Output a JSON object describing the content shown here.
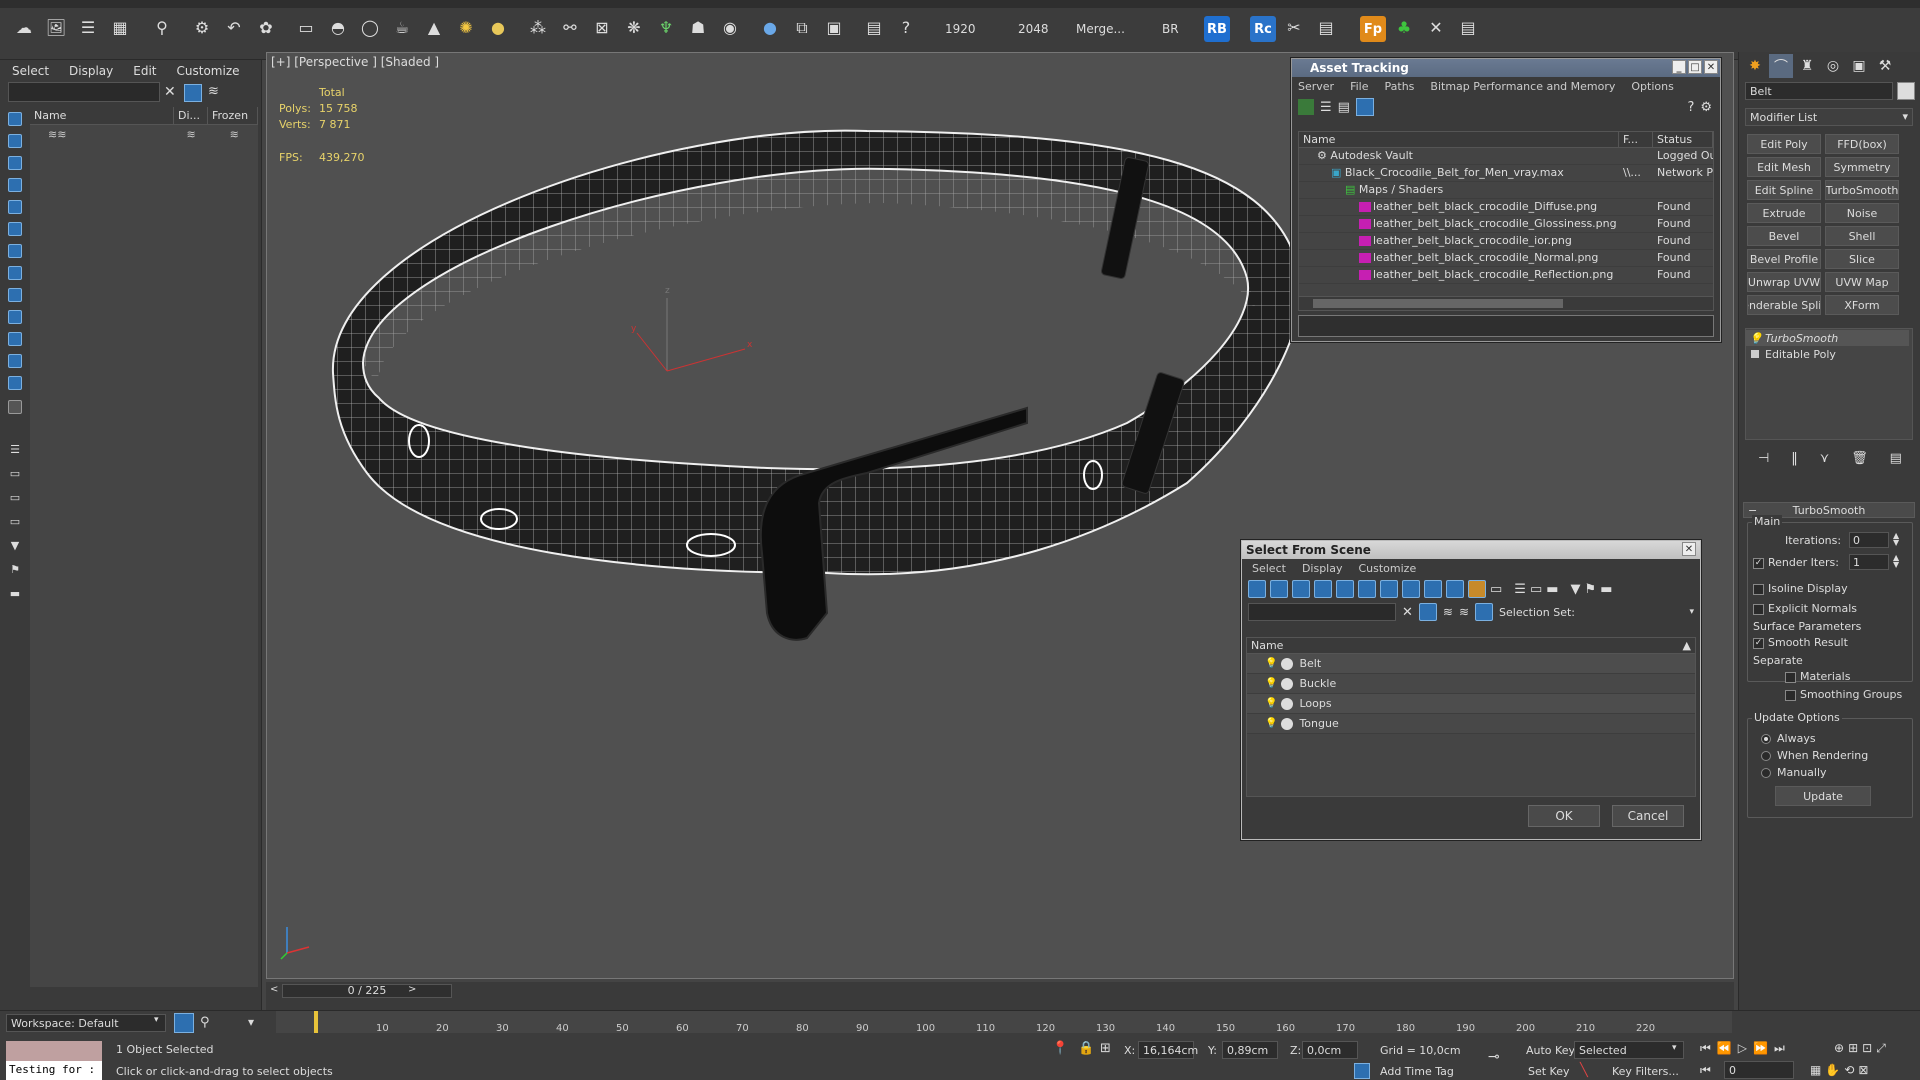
{
  "toolbar": {
    "res_width": "1920",
    "res_height": "2048",
    "merge_label": "Merge...",
    "br_label": "BR",
    "rb_label": "RB",
    "rc_label": "Rc",
    "fp_label": "Fp",
    "icons": [
      "select-object-icon",
      "open-icon",
      "layers-icon",
      "explorer-icon",
      "link-icon",
      "bind-icon",
      "undo-icon",
      "paint-icon",
      "box-icon",
      "sphere-icon",
      "cylinder-icon",
      "teapot-icon",
      "cone-icon",
      "light-icon",
      "geosphere-icon",
      "particles-icon",
      "bone-icon",
      "helper-icon",
      "space-warp-icon",
      "hair-icon",
      "render-icon",
      "material-icon",
      "render-setup-icon",
      "frame-icon",
      "help-icon"
    ]
  },
  "explorer": {
    "menus": [
      "Select",
      "Display",
      "Edit",
      "Customize"
    ],
    "columns": [
      "Name",
      "Di...",
      "Frozen"
    ],
    "workspace": "Workspace: Default"
  },
  "viewport": {
    "label": "[+] [Perspective ] [Shaded ]",
    "stats": {
      "header": "Total",
      "polys_label": "Polys:",
      "polys_value": "15 758",
      "verts_label": "Verts:",
      "verts_value": "7 871",
      "fps_label": "FPS:",
      "fps_value": "439,270"
    }
  },
  "asset_tracking": {
    "title": "Asset Tracking",
    "menus": [
      "Server",
      "File",
      "Paths",
      "Bitmap Performance and Memory",
      "Options"
    ],
    "columns": [
      "Name",
      "F...",
      "Status"
    ],
    "rows": [
      {
        "name": "Autodesk Vault",
        "path": "",
        "status": "Logged Ou",
        "indent": 1,
        "icon": "vault"
      },
      {
        "name": "Black_Crocodile_Belt_for_Men_vray.max",
        "path": "\\\\...",
        "status": "Network Pa",
        "indent": 2,
        "icon": "max"
      },
      {
        "name": "Maps / Shaders",
        "path": "",
        "status": "",
        "indent": 3,
        "icon": "maps"
      },
      {
        "name": "leather_belt_black_crocodile_Diffuse.png",
        "path": "",
        "status": "Found",
        "indent": 4,
        "icon": "png"
      },
      {
        "name": "leather_belt_black_crocodile_Glossiness.png",
        "path": "",
        "status": "Found",
        "indent": 4,
        "icon": "png"
      },
      {
        "name": "leather_belt_black_crocodile_ior.png",
        "path": "",
        "status": "Found",
        "indent": 4,
        "icon": "png"
      },
      {
        "name": "leather_belt_black_crocodile_Normal.png",
        "path": "",
        "status": "Found",
        "indent": 4,
        "icon": "png"
      },
      {
        "name": "leather_belt_black_crocodile_Reflection.png",
        "path": "",
        "status": "Found",
        "indent": 4,
        "icon": "png"
      }
    ]
  },
  "select_from_scene": {
    "title": "Select From Scene",
    "menus": [
      "Select",
      "Display",
      "Customize"
    ],
    "selection_set_label": "Selection Set:",
    "column_name": "Name",
    "objects": [
      "Belt",
      "Buckle",
      "Loops",
      "Tongue"
    ],
    "ok_label": "OK",
    "cancel_label": "Cancel"
  },
  "command_panel": {
    "object_name": "Belt",
    "modifier_list": "Modifier List",
    "modifier_buttons": [
      "Edit Poly",
      "FFD(box)",
      "Edit Mesh",
      "Symmetry",
      "Edit Spline",
      "TurboSmooth",
      "Extrude",
      "Noise",
      "Bevel",
      "Shell",
      "Bevel Profile",
      "Slice",
      "Unwrap UVW",
      "UVW Map",
      "enderable Splir",
      "XForm"
    ],
    "stack": [
      "TurboSmooth",
      "Editable Poly"
    ],
    "rollout_title": "TurboSmooth",
    "main_label": "Main",
    "iterations_label": "Iterations:",
    "iterations_value": "0",
    "render_iters_label": "Render Iters:",
    "render_iters_value": "1",
    "isoline_label": "Isoline Display",
    "explicit_normals_label": "Explicit Normals",
    "surface_params_label": "Surface Parameters",
    "smooth_result_label": "Smooth Result",
    "separate_label": "Separate",
    "materials_label": "Materials",
    "smoothing_groups_label": "Smoothing Groups",
    "update_options_label": "Update Options",
    "always_label": "Always",
    "when_rendering_label": "When Rendering",
    "manually_label": "Manually",
    "update_button": "Update"
  },
  "timeline": {
    "frame_display": "0 / 225",
    "ticks": [
      "10",
      "20",
      "30",
      "40",
      "50",
      "60",
      "70",
      "80",
      "90",
      "100",
      "110",
      "120",
      "130",
      "140",
      "150",
      "160",
      "170",
      "180",
      "190",
      "200",
      "210",
      "220"
    ]
  },
  "status": {
    "listener_text": "Testing for :",
    "objects_selected": "1 Object Selected",
    "prompt": "Click or click-and-drag to select objects",
    "x_label": "X:",
    "x_value": "16,164cm",
    "y_label": "Y:",
    "y_value": "0,89cm",
    "z_label": "Z:",
    "z_value": "0,0cm",
    "grid": "Grid = 10,0cm",
    "add_time_tag": "Add Time Tag",
    "auto_key": "Auto Key",
    "set_key": "Set Key",
    "selected_dropdown": "Selected",
    "key_filters": "Key Filters...",
    "frame_value": "0"
  },
  "colors": {
    "accent_blue": "#2d6fb0",
    "stats_yellow": "#e8d36a",
    "rb_blue": "#1f6fd0",
    "fp_orange": "#e08a1a",
    "png_magenta": "#c61fb2"
  }
}
